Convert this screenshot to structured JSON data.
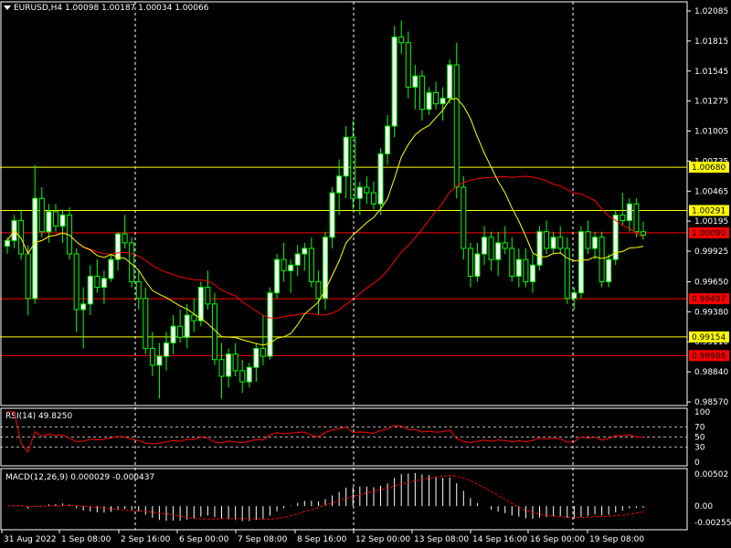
{
  "header": {
    "symbol_line": "EURUSD,H4  1.00098 1.00187 1.00034 1.00066"
  },
  "colors": {
    "background": "#000000",
    "candle_bull": "#ffffff",
    "candle_bear": "#000000",
    "candle_outline": "#00ff00",
    "ma_fast": "#ffff00",
    "ma_slow": "#ff0000",
    "level_yellow": "#ffff00",
    "level_red": "#ff0000",
    "rsi_line": "#ff0000",
    "macd_hist": "#ffffff",
    "macd_signal": "#ff0000",
    "grid": "#ffffff"
  },
  "price_axis": {
    "ticks": [
      "1.02085",
      "1.01815",
      "1.01545",
      "1.01275",
      "1.01005",
      "1.00735",
      "1.00465",
      "1.00195",
      "0.99925",
      "0.99650",
      "0.99380",
      "0.99110",
      "0.98840",
      "0.98570"
    ]
  },
  "levels": [
    {
      "price": 1.0068,
      "label": "1.00680",
      "color": "yellow"
    },
    {
      "price": 1.00291,
      "label": "1.00291",
      "color": "yellow"
    },
    {
      "price": 1.0009,
      "label": "1.00090",
      "color": "red"
    },
    {
      "price": 0.99497,
      "label": "0.99497",
      "color": "red"
    },
    {
      "price": 0.99154,
      "label": "0.99154",
      "color": "yellow"
    },
    {
      "price": 0.98986,
      "label": "0.98986",
      "color": "red"
    }
  ],
  "time_axis": {
    "labels": [
      "31 Aug 2022",
      "1 Sep 08:00",
      "2 Sep 16:00",
      "6 Sep 00:00",
      "7 Sep 08:00",
      "8 Sep 16:00",
      "12 Sep 00:00",
      "13 Sep 08:00",
      "14 Sep 16:00",
      "16 Sep 00:00",
      "19 Sep 08:00"
    ]
  },
  "rsi": {
    "title": "RSI(14) 49.8250",
    "ticks": [
      "100",
      "70",
      "50",
      "30",
      "0"
    ]
  },
  "macd": {
    "title": "MACD(12,26,9) 0.000029 -0.000437",
    "ticks": [
      "0.00502",
      "0.00",
      "-0.002553"
    ]
  },
  "chart_data": {
    "type": "candlestick",
    "symbol": "EURUSD",
    "timeframe": "H4",
    "ylim": [
      0.9857,
      1.02085
    ],
    "candles": [
      [
        0.9997,
        1.0005,
        0.999,
        1.0002
      ],
      [
        1.0002,
        1.0025,
        0.9995,
        1.002
      ],
      [
        1.002,
        1.003,
        0.9985,
        0.999
      ],
      [
        0.999,
        0.9998,
        0.9935,
        0.995
      ],
      [
        0.995,
        1.007,
        0.9945,
        1.004
      ],
      [
        1.004,
        1.005,
        1.0005,
        1.001
      ],
      [
        1.001,
        1.0035,
        1.0,
        1.0028
      ],
      [
        1.0028,
        1.0035,
        1.001,
        1.0015
      ],
      [
        1.0015,
        1.003,
        1.0,
        1.0025
      ],
      [
        1.0025,
        1.0032,
        0.9985,
        0.999
      ],
      [
        0.999,
        0.9995,
        0.992,
        0.994
      ],
      [
        0.994,
        0.996,
        0.9905,
        0.9945
      ],
      [
        0.9945,
        0.998,
        0.9935,
        0.997
      ],
      [
        0.997,
        0.9985,
        0.9955,
        0.996
      ],
      [
        0.996,
        0.9975,
        0.9945,
        0.9968
      ],
      [
        0.9968,
        0.999,
        0.9965,
        0.9985
      ],
      [
        0.9985,
        1.001,
        0.9975,
        1.0008
      ],
      [
        1.0008,
        1.0025,
        0.9995,
        1.0
      ],
      [
        1.0,
        1.0005,
        0.996,
        0.9965
      ],
      [
        0.9965,
        0.9975,
        0.994,
        0.995
      ],
      [
        0.995,
        0.996,
        0.99,
        0.9905
      ],
      [
        0.9905,
        0.992,
        0.988,
        0.989
      ],
      [
        0.989,
        0.991,
        0.986,
        0.9898
      ],
      [
        0.9898,
        0.992,
        0.9885,
        0.991
      ],
      [
        0.991,
        0.9935,
        0.99,
        0.9925
      ],
      [
        0.9925,
        0.994,
        0.991,
        0.9915
      ],
      [
        0.9915,
        0.9945,
        0.9905,
        0.9935
      ],
      [
        0.9935,
        0.995,
        0.992,
        0.993
      ],
      [
        0.993,
        0.9965,
        0.9925,
        0.996
      ],
      [
        0.996,
        0.9975,
        0.994,
        0.9945
      ],
      [
        0.9945,
        0.9955,
        0.989,
        0.9895
      ],
      [
        0.9895,
        0.991,
        0.986,
        0.988
      ],
      [
        0.988,
        0.9905,
        0.987,
        0.99
      ],
      [
        0.99,
        0.991,
        0.988,
        0.9885
      ],
      [
        0.9885,
        0.9895,
        0.9865,
        0.9875
      ],
      [
        0.9875,
        0.9892,
        0.987,
        0.9888
      ],
      [
        0.9888,
        0.991,
        0.9875,
        0.9905
      ],
      [
        0.9905,
        0.9935,
        0.989,
        0.9898
      ],
      [
        0.9898,
        0.996,
        0.9895,
        0.9955
      ],
      [
        0.9955,
        0.999,
        0.995,
        0.9985
      ],
      [
        0.9985,
        1.0,
        0.9965,
        0.9975
      ],
      [
        0.9975,
        0.9985,
        0.9955,
        0.998
      ],
      [
        0.998,
        0.9998,
        0.997,
        0.999
      ],
      [
        0.999,
        1.0,
        0.9975,
        0.9995
      ],
      [
        0.9995,
        1.0005,
        0.996,
        0.9965
      ],
      [
        0.9965,
        0.9975,
        0.9935,
        0.995
      ],
      [
        0.995,
        1.001,
        0.994,
        1.0005
      ],
      [
        1.0005,
        1.005,
        0.9995,
        1.0045
      ],
      [
        1.0045,
        1.0075,
        1.0025,
        1.006
      ],
      [
        1.006,
        1.0105,
        1.004,
        1.0095
      ],
      [
        1.0095,
        1.011,
        1.003,
        1.004
      ],
      [
        1.004,
        1.0055,
        1.0025,
        1.005
      ],
      [
        1.005,
        1.006,
        1.0035,
        1.0045
      ],
      [
        1.0045,
        1.0055,
        1.003,
        1.0035
      ],
      [
        1.0035,
        1.0085,
        1.0025,
        1.008
      ],
      [
        1.008,
        1.0115,
        1.007,
        1.0105
      ],
      [
        1.0105,
        1.0195,
        1.0095,
        1.0185
      ],
      [
        1.0185,
        1.02,
        1.017,
        1.018
      ],
      [
        1.018,
        1.019,
        1.013,
        1.014
      ],
      [
        1.014,
        1.016,
        1.012,
        1.015
      ],
      [
        1.015,
        1.0155,
        1.011,
        1.012
      ],
      [
        1.012,
        1.014,
        1.0115,
        1.0135
      ],
      [
        1.0135,
        1.0145,
        1.012,
        1.0125
      ],
      [
        1.0125,
        1.014,
        1.011,
        1.013
      ],
      [
        1.013,
        1.0165,
        1.0125,
        1.016
      ],
      [
        1.016,
        1.018,
        1.004,
        1.005
      ],
      [
        1.005,
        1.006,
        0.9985,
        0.9995
      ],
      [
        0.9995,
        1.0,
        0.996,
        0.997
      ],
      [
        0.997,
        1.0,
        0.9965,
        0.999
      ],
      [
        0.999,
        1.0015,
        0.998,
        1.0005
      ],
      [
        1.0005,
        1.001,
        0.9975,
        0.9985
      ],
      [
        0.9985,
        1.001,
        0.997,
        1.0
      ],
      [
        1.0,
        1.0015,
        0.999,
        0.9995
      ],
      [
        0.9995,
        1.0005,
        0.9965,
        0.997
      ],
      [
        0.997,
        0.9995,
        0.996,
        0.9985
      ],
      [
        0.9985,
        0.9995,
        0.996,
        0.9965
      ],
      [
        0.9965,
        0.999,
        0.9955,
        0.998
      ],
      [
        0.998,
        1.0015,
        0.9975,
        1.001
      ],
      [
        1.001,
        1.002,
        0.999,
        0.9995
      ],
      [
        0.9995,
        1.001,
        0.999,
        1.0005
      ],
      [
        1.0005,
        1.0015,
        0.999,
        0.9995
      ],
      [
        0.9995,
        1.0005,
        0.9945,
        0.995
      ],
      [
        0.995,
        0.996,
        0.994,
        0.9955
      ],
      [
        0.9955,
        1.0015,
        0.995,
        1.001
      ],
      [
        1.001,
        1.002,
        0.999,
        0.9995
      ],
      [
        0.9995,
        1.001,
        0.9985,
        1.0005
      ],
      [
        1.0005,
        1.001,
        0.996,
        0.9965
      ],
      [
        0.9965,
        0.999,
        0.996,
        0.9985
      ],
      [
        0.9985,
        1.003,
        0.998,
        1.0025
      ],
      [
        1.0025,
        1.0045,
        1.0015,
        1.002
      ],
      [
        1.002,
        1.004,
        1.001,
        1.0035
      ],
      [
        1.0035,
        1.004,
        1.0005,
        1.001
      ],
      [
        1.001,
        1.0019,
        1.0003,
        1.0007
      ]
    ],
    "ma_fast_label": "",
    "ma_slow_label": ""
  }
}
